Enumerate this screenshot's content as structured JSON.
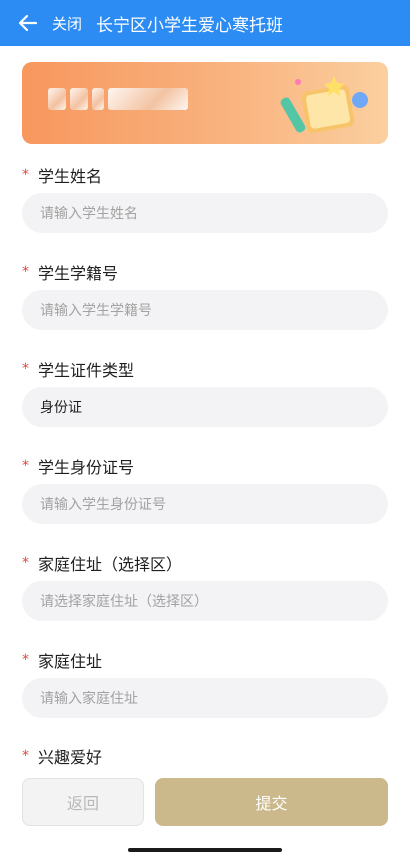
{
  "header": {
    "close_label": "关闭",
    "title": "长宁区小学生爱心寒托班",
    "bg_color": "#2c8cf4"
  },
  "fields": [
    {
      "label": "学生姓名",
      "placeholder": "请输入学生姓名",
      "value": "",
      "required": true
    },
    {
      "label": "学生学籍号",
      "placeholder": "请输入学生学籍号",
      "value": "",
      "required": true
    },
    {
      "label": "学生证件类型",
      "placeholder": "",
      "value": "身份证",
      "required": true
    },
    {
      "label": "学生身份证号",
      "placeholder": "请输入学生身份证号",
      "value": "",
      "required": true
    },
    {
      "label": "家庭住址（选择区）",
      "placeholder": "请选择家庭住址（选择区）",
      "value": "",
      "required": true
    },
    {
      "label": "家庭住址",
      "placeholder": "请输入家庭住址",
      "value": "",
      "required": true
    },
    {
      "label": "兴趣爱好",
      "required": true
    }
  ],
  "required_mark": "*",
  "footer": {
    "back_label": "返回",
    "submit_label": "提交",
    "submit_color": "#cbb98b"
  }
}
